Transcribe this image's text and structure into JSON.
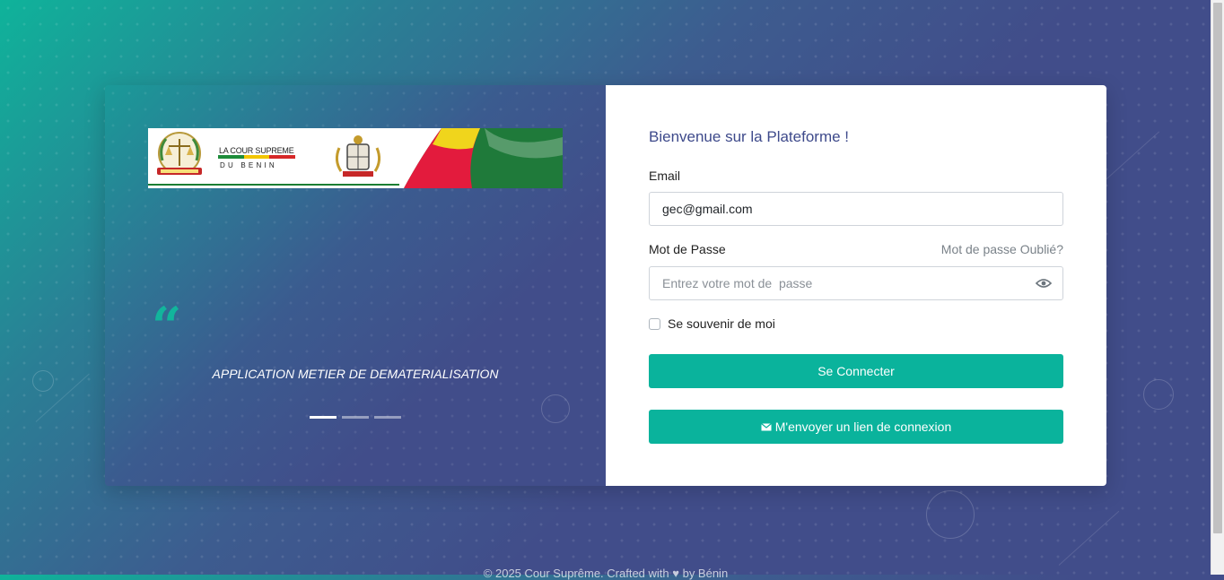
{
  "colors": {
    "accent": "#0ab39c",
    "title": "#3e4a8b",
    "background": "#414d8a"
  },
  "banner": {
    "line1": "LA COUR SUPREME",
    "line2": "DU BENIN"
  },
  "carousel": {
    "quote_icon": "quote-icon",
    "text": "APPLICATION METIER DE DEMATERIALISATION",
    "slides": 3,
    "active_slide": 1
  },
  "form": {
    "title": "Bienvenue sur la Plateforme !",
    "email_label": "Email",
    "email_value": "gec@gmail.com",
    "password_label": "Mot de Passe",
    "forgot_link": "Mot de passe Oublié?",
    "password_placeholder": "Entrez votre mot de  passe",
    "remember_label": "Se souvenir de moi",
    "login_button": "Se Connecter",
    "magic_link_button": "M'envoyer un lien de connexion"
  },
  "footer": {
    "text": "© 2025 Cour Suprême. Crafted with ♥ by Bénin"
  }
}
